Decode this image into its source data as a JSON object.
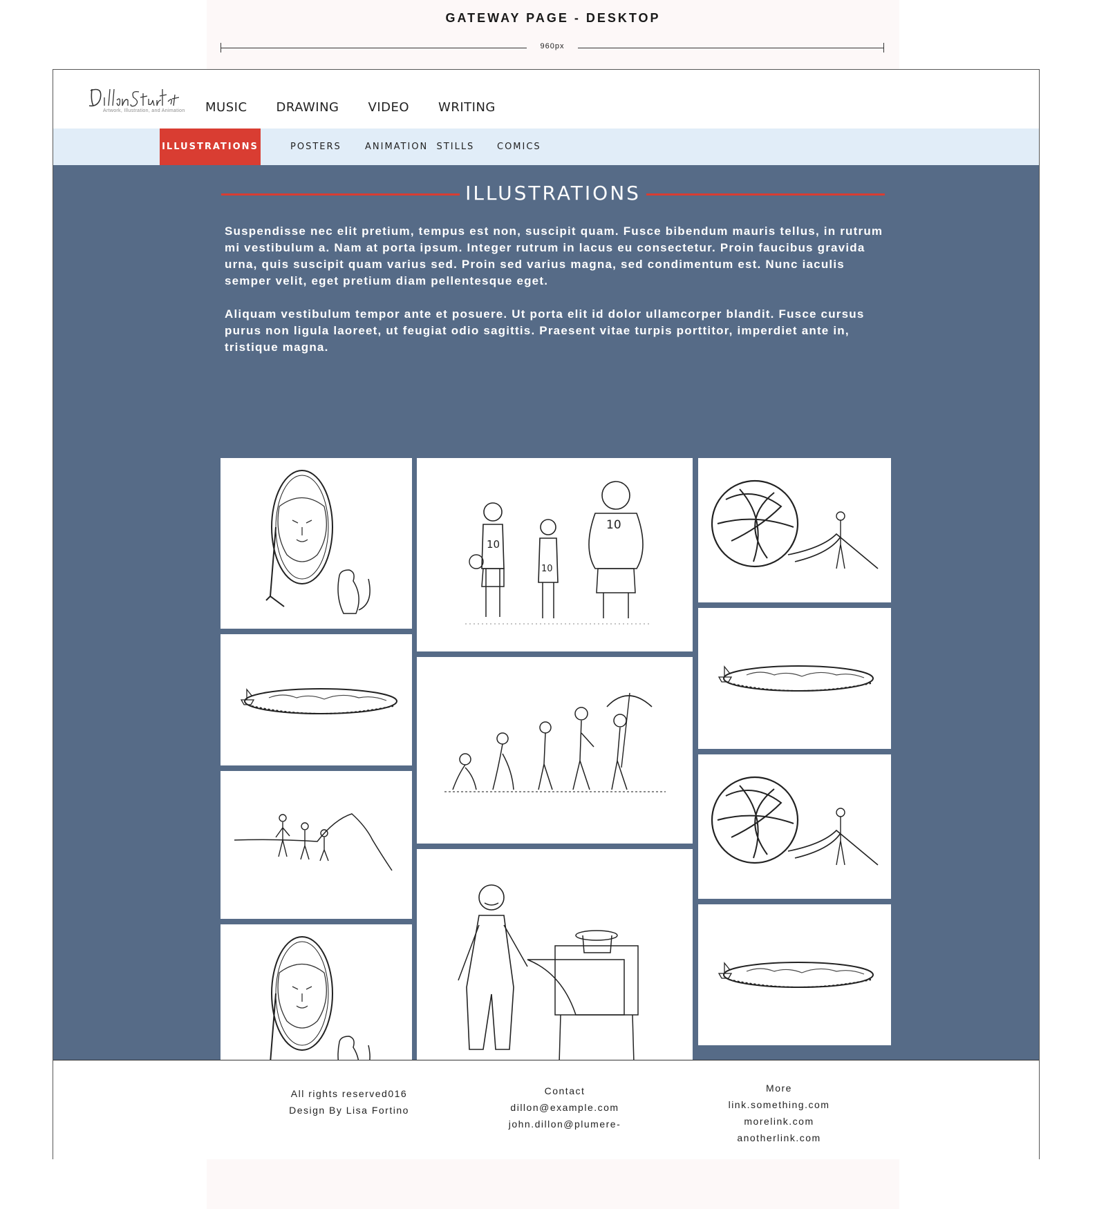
{
  "spec": {
    "title": "GATEWAY PAGE - DESKTOP",
    "width_label": "960px"
  },
  "header": {
    "logo_text": "Dillon Sturtevant",
    "logo_tagline": "Artwork, Illustration, and Animation",
    "nav": [
      "MUSIC",
      "DRAWING",
      "VIDEO",
      "WRITING"
    ]
  },
  "subnav": {
    "items": [
      "ILLUSTRATIONS",
      "POSTERS",
      "ANIMATION  STILLS",
      "COMICS"
    ],
    "active": "ILLUSTRATIONS"
  },
  "section": {
    "title": "ILLUSTRATIONS",
    "paragraphs": [
      "Suspendisse nec elit pretium, tempus est non, suscipit quam. Fusce bibendum mauris tellus, in rutrum mi vestibulum a. Nam at porta ipsum. Integer rutrum in lacus eu consectetur. Proin faucibus gravida urna, quis suscipit quam varius sed. Proin sed varius magna, sed condimentum est. Nunc iaculis semper velit, eget pretium diam pellentesque eget.",
      "Aliquam vestibulum tempor ante et posuere. Ut porta elit id dolor ullamcorper blandit. Fusce cursus purus non ligula laoreet, ut feugiat odio sagittis. Praesent vitae turpis porttitor, imperdiet ante in, tristique magna."
    ]
  },
  "gallery": [
    {
      "icon": "lion-mirror-illustration"
    },
    {
      "icon": "flat-earth-illustration"
    },
    {
      "icon": "hikers-mountain-illustration"
    },
    {
      "icon": "lion-mirror-illustration"
    },
    {
      "icon": "basketball-players-illustration"
    },
    {
      "icon": "evolution-illustration"
    },
    {
      "icon": "magician-illustration"
    },
    {
      "icon": "yarn-ball-illustration"
    },
    {
      "icon": "flat-earth-illustration"
    },
    {
      "icon": "yarn-ball-illustration"
    },
    {
      "icon": "flat-earth-illustration"
    }
  ],
  "footer": {
    "rights": [
      "All rights reserved016",
      "Design By Lisa Fortino"
    ],
    "contact": [
      "Contact",
      "dillon@example.com",
      "john.dillon@plumere-"
    ],
    "more": [
      "More",
      "link.something.com",
      "morelink.com",
      "anotherlink.com"
    ]
  },
  "colors": {
    "accent": "#d93d32",
    "content_bg": "#566b87",
    "subnav_bg": "#e1edf8"
  }
}
